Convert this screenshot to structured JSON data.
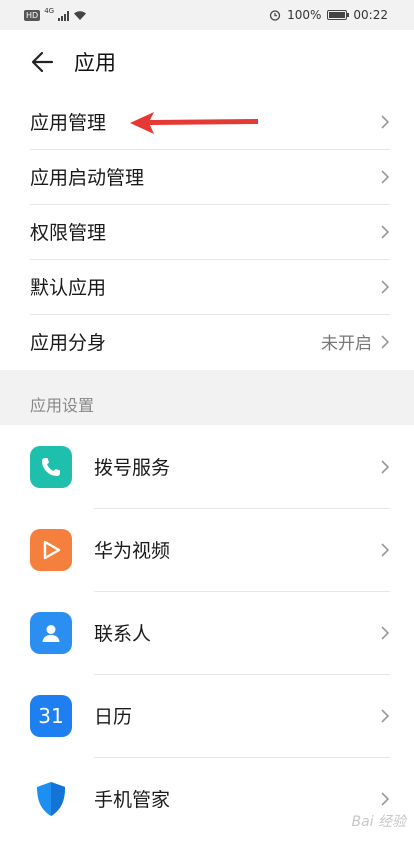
{
  "status_bar": {
    "left_badge": "HD",
    "network": "4G",
    "battery": "100%",
    "time": "00:22"
  },
  "header": {
    "title": "应用"
  },
  "settings": [
    {
      "label": "应用管理",
      "value": ""
    },
    {
      "label": "应用启动管理",
      "value": ""
    },
    {
      "label": "权限管理",
      "value": ""
    },
    {
      "label": "默认应用",
      "value": ""
    },
    {
      "label": "应用分身",
      "value": "未开启"
    }
  ],
  "section_title": "应用设置",
  "apps": [
    {
      "label": "拨号服务",
      "icon": "phone-icon",
      "color": "#1fbfad"
    },
    {
      "label": "华为视频",
      "icon": "video-play-icon",
      "color": "#f5803e"
    },
    {
      "label": "联系人",
      "icon": "contact-person-icon",
      "color": "#2a8ff0"
    },
    {
      "label": "日历",
      "icon": "calendar-icon",
      "color": "#1e7ff0",
      "icon_text": "31"
    },
    {
      "label": "手机管家",
      "icon": "shield-icon",
      "color": "#1d8ff2"
    }
  ],
  "annotation_color": "#e53935",
  "watermark": "Bai 经验"
}
